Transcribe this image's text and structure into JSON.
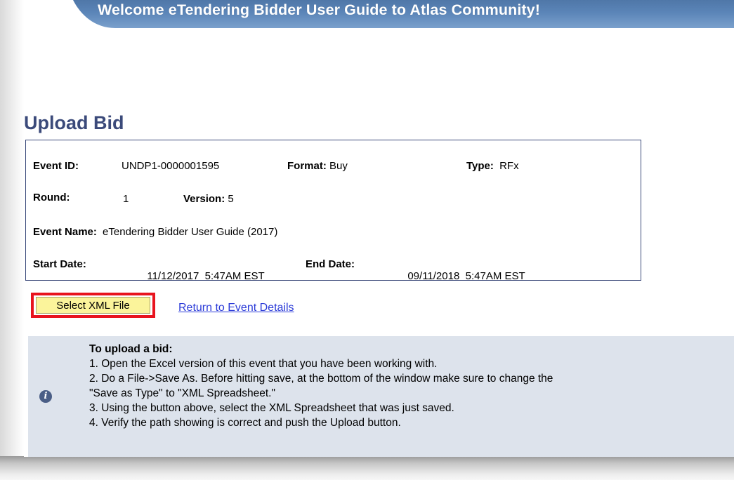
{
  "header": {
    "title": "Welcome eTendering Bidder User Guide to Atlas Community!"
  },
  "page": {
    "title": "Upload Bid"
  },
  "event": {
    "event_id_label": "Event ID:",
    "event_id": "UNDP1-0000001595",
    "format_label": "Format:",
    "format": "Buy",
    "type_label": "Type:",
    "type": "RFx",
    "round_label": "Round:",
    "round": "1",
    "version_label": "Version:",
    "version": "5",
    "name_label": "Event Name:",
    "name": "eTendering Bidder User Guide (2017)",
    "start_label": "Start Date:",
    "start": "11/12/2017  5:47AM EST",
    "end_label": "End Date:",
    "end": "09/11/2018  5:47AM EST"
  },
  "actions": {
    "select_xml_label": "Select XML File",
    "return_link": "Return to Event Details"
  },
  "help": {
    "icon": "info-icon",
    "heading": "To upload a bid:",
    "lines": [
      "1. Open the Excel version of this event that you have been working with.",
      "2. Do a File->Save As. Before hitting save, at the bottom of the window make sure to change the",
      "\"Save as Type\" to \"XML Spreadsheet.\"",
      "3. Using the button above, select the XML Spreadsheet that was just saved.",
      "4. Verify the path showing is correct and push the Upload button."
    ]
  },
  "colors": {
    "banner": "#5b85b8",
    "title": "#3b4a7a",
    "button_bg": "#fbf49b",
    "highlight": "#e8141e",
    "link": "#2b3bd8",
    "help_bg": "#dde3ec"
  }
}
